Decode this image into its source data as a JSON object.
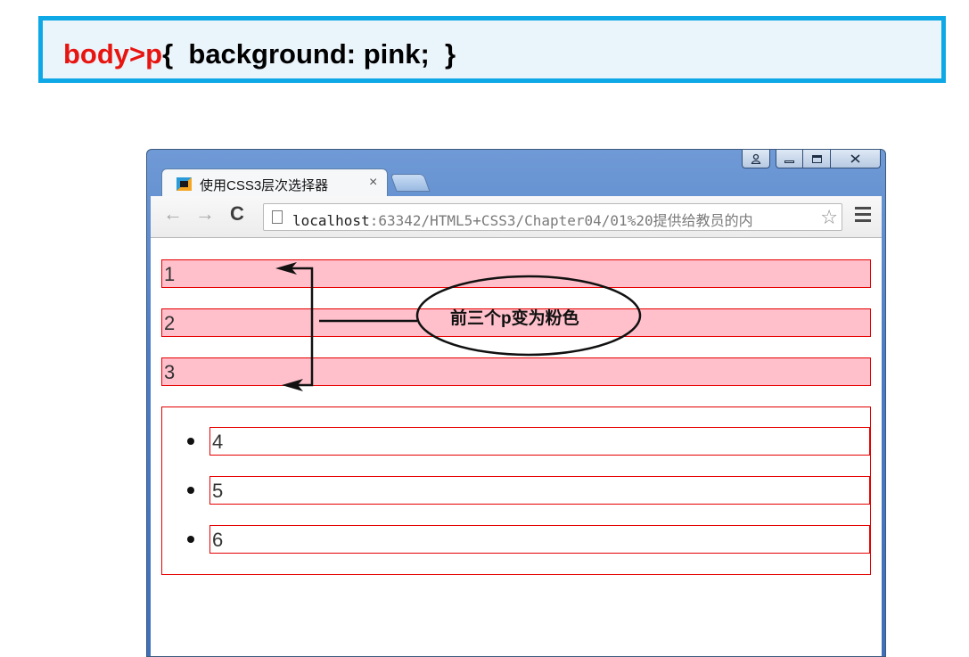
{
  "code": {
    "selector": "body>p",
    "declaration": "{  background: pink;  }"
  },
  "browser": {
    "tab_title": "使用CSS3层次选择器",
    "tab_close": "×",
    "url_host": "localhost",
    "url_rest": ":63342/HTML5+CSS3/Chapter04/01%20提供给教员的内",
    "back": "←",
    "forward": "→",
    "reload": "C",
    "star": "☆"
  },
  "page": {
    "paragraphs": [
      "1",
      "2",
      "3"
    ],
    "list_items": [
      "4",
      "5",
      "6"
    ]
  },
  "annotation": {
    "text": "前三个p变为粉色"
  },
  "colors": {
    "selector": "#e8140f",
    "pink": "#ffc0cb",
    "border_red": "#e60000",
    "banner_border": "#0fa8e6"
  }
}
